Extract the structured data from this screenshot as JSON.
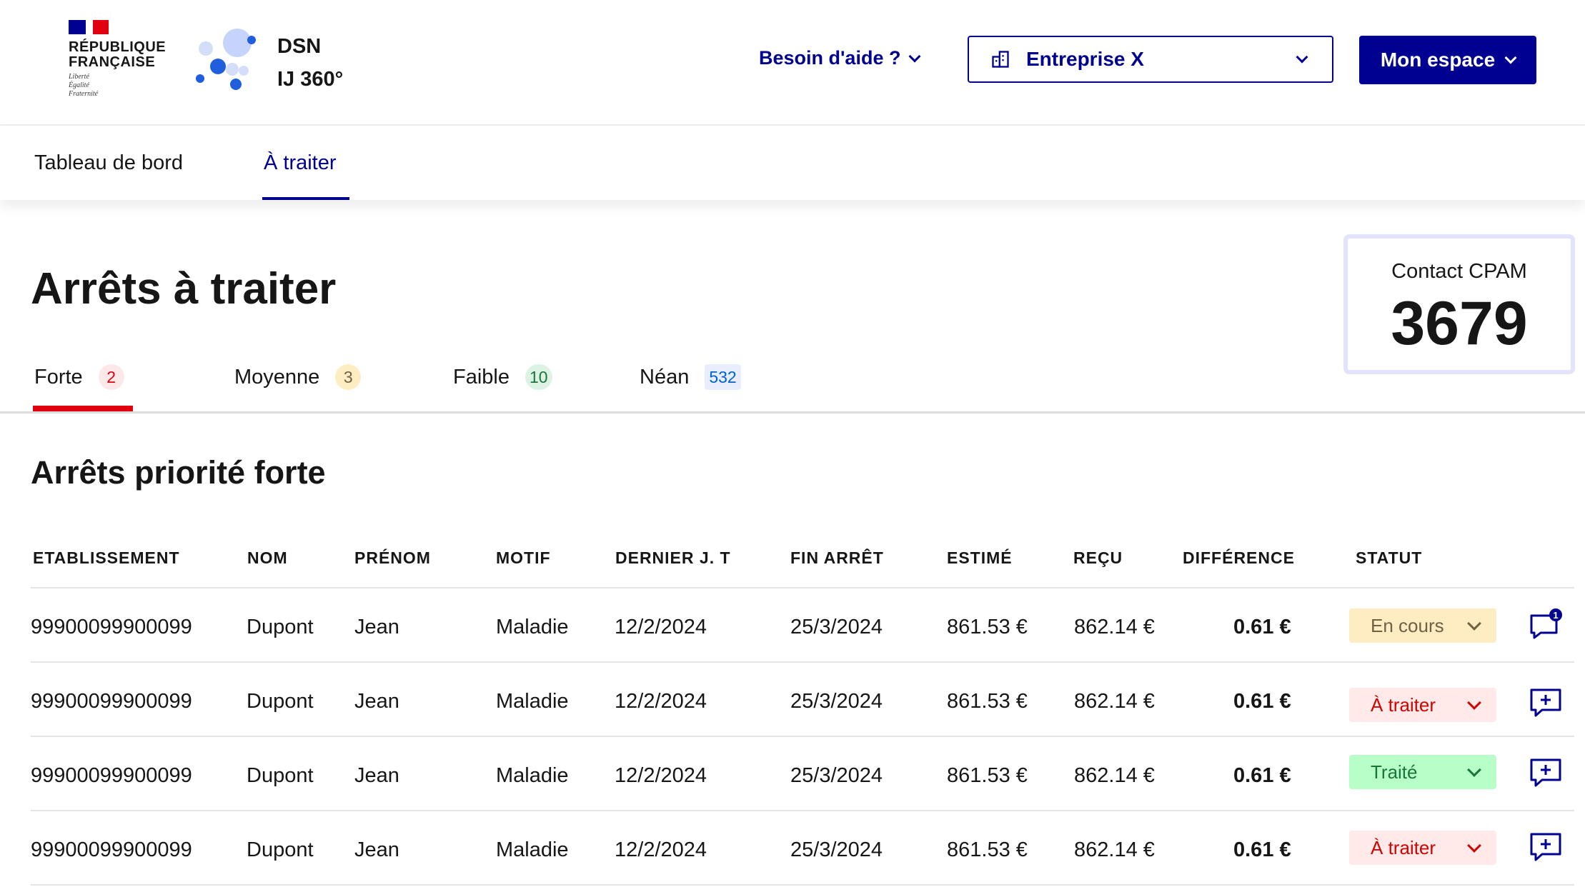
{
  "header": {
    "republique_line1": "RÉPUBLIQUE",
    "republique_line2": "FRANÇAISE",
    "motto_1": "Liberté",
    "motto_2": "Égalité",
    "motto_3": "Fraternité",
    "brand_line1": "DSN",
    "brand_line2": "IJ 360°",
    "help_label": "Besoin d'aide ?",
    "entreprise_label": "Entreprise X",
    "mon_espace_label": "Mon espace"
  },
  "nav": {
    "items": [
      {
        "label": "Tableau de bord"
      },
      {
        "label": "À traiter"
      }
    ],
    "active": "À traiter"
  },
  "main": {
    "title": "Arrêts à traiter",
    "contact": {
      "label": "Contact CPAM",
      "value": "3679"
    },
    "tabs": [
      {
        "label": "Forte",
        "count": "2"
      },
      {
        "label": "Moyenne",
        "count": "3"
      },
      {
        "label": "Faible",
        "count": "10"
      },
      {
        "label": "Néan",
        "count": "532"
      }
    ],
    "active_tab": "Forte",
    "section_title": "Arrêts priorité forte"
  },
  "table": {
    "columns": [
      "ETABLISSEMENT",
      "NOM",
      "PRÉNOM",
      "MOTIF",
      "DERNIER J. T",
      "FIN ARRÊT",
      "ESTIMÉ",
      "REÇU",
      "DIFFÉRENCE",
      "STATUT"
    ],
    "rows": [
      {
        "etablissement": "99900099900099",
        "nom": "Dupont",
        "prenom": "Jean",
        "motif": "Maladie",
        "dernier_jt": "12/2/2024",
        "fin_arret": "25/3/2024",
        "estime": "861.53 €",
        "recu": "862.14 €",
        "difference": "0.61 €",
        "statut": "En cours",
        "comment_count": "1"
      },
      {
        "etablissement": "99900099900099",
        "nom": "Dupont",
        "prenom": "Jean",
        "motif": "Maladie",
        "dernier_jt": "12/2/2024",
        "fin_arret": "25/3/2024",
        "estime": "861.53 €",
        "recu": "862.14 €",
        "difference": "0.61 €",
        "statut": "À traiter"
      },
      {
        "etablissement": "99900099900099",
        "nom": "Dupont",
        "prenom": "Jean",
        "motif": "Maladie",
        "dernier_jt": "12/2/2024",
        "fin_arret": "25/3/2024",
        "estime": "861.53 €",
        "recu": "862.14 €",
        "difference": "0.61 €",
        "statut": "Traité"
      },
      {
        "etablissement": "99900099900099",
        "nom": "Dupont",
        "prenom": "Jean",
        "motif": "Maladie",
        "dernier_jt": "12/2/2024",
        "fin_arret": "25/3/2024",
        "estime": "861.53 €",
        "recu": "862.14 €",
        "difference": "0.61 €",
        "statut": "À traiter"
      }
    ]
  },
  "icons": {
    "entreprise": "building-icon",
    "comment": "comment-icon",
    "comment_add": "comment-add-icon",
    "chevron": "chevron-down-icon"
  },
  "colors": {
    "primary": "#000091",
    "forte": "#e1000f",
    "status_en_cours_bg": "#feecc2",
    "status_a_traiter_bg": "#ffe9e9",
    "status_traite_bg": "#b8fec9"
  }
}
